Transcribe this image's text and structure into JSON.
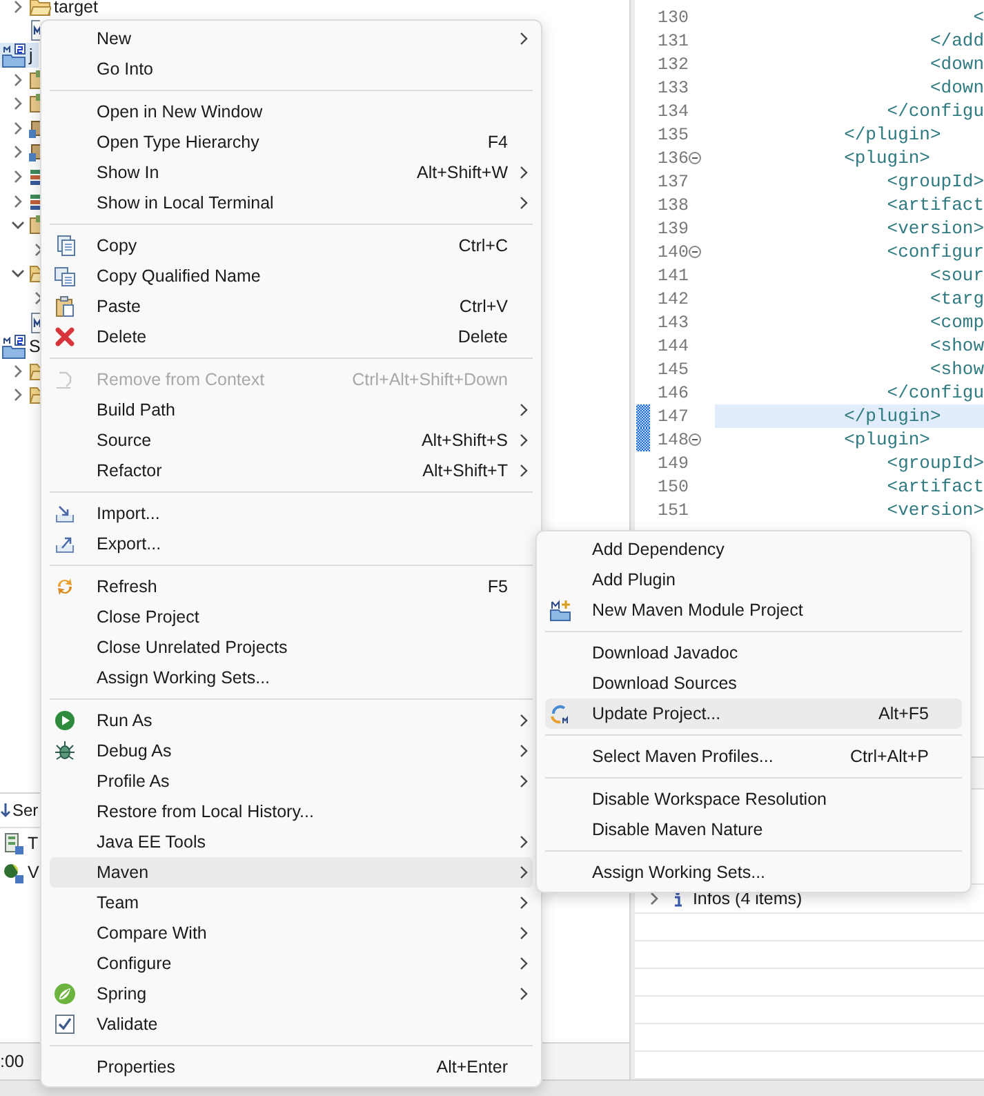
{
  "explorer": {
    "tree": [
      {
        "kind": "folder",
        "label": "target",
        "expanded": false,
        "selected": false
      },
      {
        "kind": "maven-file",
        "selected": false
      },
      {
        "kind": "project",
        "label": "j",
        "selected": true,
        "children": [
          {
            "kind": "source-folder",
            "expanded": false,
            "selected": false
          },
          {
            "kind": "source-folder",
            "expanded": false,
            "selected": false
          },
          {
            "kind": "package",
            "expanded": false,
            "selected": false
          },
          {
            "kind": "package",
            "expanded": false,
            "selected": false
          },
          {
            "kind": "library",
            "expanded": false,
            "selected": false
          },
          {
            "kind": "library",
            "expanded": false,
            "selected": false
          },
          {
            "kind": "source-folder",
            "expanded": true,
            "selected": false,
            "children": [
              {
                "expanded": false,
                "selected": false
              }
            ]
          },
          {
            "kind": "folder",
            "expanded": true,
            "selected": false,
            "children": [
              {
                "expanded": false,
                "selected": false
              }
            ]
          },
          {
            "kind": "maven-file",
            "selected": false
          }
        ]
      },
      {
        "kind": "project",
        "label": "S",
        "selected": false,
        "children": [
          {
            "kind": "folder",
            "expanded": false,
            "selected": false
          },
          {
            "kind": "folder",
            "expanded": false,
            "selected": false
          }
        ]
      }
    ]
  },
  "servers": {
    "tab": "Ser",
    "rows": [
      {
        "kind": "server",
        "label": "T"
      },
      {
        "kind": "spring",
        "label": "V"
      }
    ]
  },
  "status_bar": {
    "text": ":00"
  },
  "editor": {
    "lines": [
      {
        "number": "130",
        "code": "                        <",
        "fold": false,
        "changed": false,
        "highlighted": false
      },
      {
        "number": "131",
        "code": "                    </add",
        "fold": false,
        "changed": false,
        "highlighted": false
      },
      {
        "number": "132",
        "code": "                    <down",
        "fold": false,
        "changed": false,
        "highlighted": false
      },
      {
        "number": "133",
        "code": "                    <down",
        "fold": false,
        "changed": false,
        "highlighted": false
      },
      {
        "number": "134",
        "code": "                </configu",
        "fold": false,
        "changed": false,
        "highlighted": false
      },
      {
        "number": "135",
        "code": "            </plugin>",
        "fold": false,
        "changed": false,
        "highlighted": false
      },
      {
        "number": "136",
        "code": "            <plugin>",
        "fold": true,
        "changed": false,
        "highlighted": false
      },
      {
        "number": "137",
        "code": "                <groupId>",
        "fold": false,
        "changed": false,
        "highlighted": false
      },
      {
        "number": "138",
        "code": "                <artifact",
        "fold": false,
        "changed": false,
        "highlighted": false
      },
      {
        "number": "139",
        "code": "                <version>",
        "fold": false,
        "changed": false,
        "highlighted": false
      },
      {
        "number": "140",
        "code": "                <configur",
        "fold": true,
        "changed": false,
        "highlighted": false
      },
      {
        "number": "141",
        "code": "                    <sour",
        "fold": false,
        "changed": false,
        "highlighted": false
      },
      {
        "number": "142",
        "code": "                    <targ",
        "fold": false,
        "changed": false,
        "highlighted": false
      },
      {
        "number": "143",
        "code": "                    <comp",
        "fold": false,
        "changed": false,
        "highlighted": false
      },
      {
        "number": "144",
        "code": "                    <show",
        "fold": false,
        "changed": false,
        "highlighted": false
      },
      {
        "number": "145",
        "code": "                    <show",
        "fold": false,
        "changed": false,
        "highlighted": false
      },
      {
        "number": "146",
        "code": "                </configu",
        "fold": false,
        "changed": false,
        "highlighted": false
      },
      {
        "number": "147",
        "code": "            </plugin>",
        "fold": false,
        "changed": true,
        "highlighted": true
      },
      {
        "number": "148",
        "code": "            <plugin>",
        "fold": true,
        "changed": true,
        "highlighted": false
      },
      {
        "number": "149",
        "code": "                <groupId>",
        "fold": false,
        "changed": false,
        "highlighted": false
      },
      {
        "number": "150",
        "code": "                <artifact",
        "fold": false,
        "changed": false,
        "highlighted": false
      },
      {
        "number": "151",
        "code": "                <version>",
        "fold": false,
        "changed": false,
        "highlighted": false
      }
    ]
  },
  "problems": {
    "rows": [
      {
        "label": "Infos (4 items)",
        "expanded": false
      }
    ]
  },
  "context_menu": {
    "items": [
      {
        "kind": "item",
        "label": "New",
        "submenu": true,
        "disabled": false,
        "selected": false
      },
      {
        "kind": "item",
        "label": "Go Into",
        "submenu": false,
        "disabled": false,
        "selected": false
      },
      {
        "kind": "separator"
      },
      {
        "kind": "item",
        "label": "Open in New Window",
        "submenu": false,
        "disabled": false,
        "selected": false
      },
      {
        "kind": "item",
        "label": "Open Type Hierarchy",
        "shortcut": "F4",
        "submenu": false,
        "disabled": false,
        "selected": false
      },
      {
        "kind": "item",
        "label": "Show In",
        "shortcut": "Alt+Shift+W",
        "submenu": true,
        "disabled": false,
        "selected": false
      },
      {
        "kind": "item",
        "label": "Show in Local Terminal",
        "submenu": true,
        "disabled": false,
        "selected": false
      },
      {
        "kind": "separator"
      },
      {
        "kind": "copy",
        "label": "Copy",
        "shortcut": "Ctrl+C",
        "submenu": false,
        "disabled": false,
        "selected": false
      },
      {
        "kind": "copy-qualified",
        "label": "Copy Qualified Name",
        "submenu": false,
        "disabled": false,
        "selected": false
      },
      {
        "kind": "paste",
        "label": "Paste",
        "shortcut": "Ctrl+V",
        "submenu": false,
        "disabled": false,
        "selected": false
      },
      {
        "kind": "delete",
        "label": "Delete",
        "shortcut": "Delete",
        "submenu": false,
        "disabled": false,
        "selected": false
      },
      {
        "kind": "separator"
      },
      {
        "kind": "remove",
        "label": "Remove from Context",
        "shortcut": "Ctrl+Alt+Shift+Down",
        "submenu": false,
        "disabled": true,
        "selected": false
      },
      {
        "kind": "item",
        "label": "Build Path",
        "submenu": true,
        "disabled": false,
        "selected": false
      },
      {
        "kind": "item",
        "label": "Source",
        "shortcut": "Alt+Shift+S",
        "submenu": true,
        "disabled": false,
        "selected": false
      },
      {
        "kind": "item",
        "label": "Refactor",
        "shortcut": "Alt+Shift+T",
        "submenu": true,
        "disabled": false,
        "selected": false
      },
      {
        "kind": "separator"
      },
      {
        "kind": "import",
        "label": "Import...",
        "submenu": false,
        "disabled": false,
        "selected": false
      },
      {
        "kind": "export",
        "label": "Export...",
        "submenu": false,
        "disabled": false,
        "selected": false
      },
      {
        "kind": "separator"
      },
      {
        "kind": "refresh",
        "label": "Refresh",
        "shortcut": "F5",
        "submenu": false,
        "disabled": false,
        "selected": false
      },
      {
        "kind": "item",
        "label": "Close Project",
        "submenu": false,
        "disabled": false,
        "selected": false
      },
      {
        "kind": "item",
        "label": "Close Unrelated Projects",
        "submenu": false,
        "disabled": false,
        "selected": false
      },
      {
        "kind": "item",
        "label": "Assign Working Sets...",
        "submenu": false,
        "disabled": false,
        "selected": false
      },
      {
        "kind": "separator"
      },
      {
        "kind": "run",
        "label": "Run As",
        "submenu": true,
        "disabled": false,
        "selected": false
      },
      {
        "kind": "debug",
        "label": "Debug As",
        "submenu": true,
        "disabled": false,
        "selected": false
      },
      {
        "kind": "item",
        "label": "Profile As",
        "submenu": true,
        "disabled": false,
        "selected": false
      },
      {
        "kind": "item",
        "label": "Restore from Local History...",
        "submenu": false,
        "disabled": false,
        "selected": false
      },
      {
        "kind": "item",
        "label": "Java EE Tools",
        "submenu": true,
        "disabled": false,
        "selected": false
      },
      {
        "kind": "item",
        "label": "Maven",
        "submenu": true,
        "disabled": false,
        "selected": true
      },
      {
        "kind": "item",
        "label": "Team",
        "submenu": true,
        "disabled": false,
        "selected": false
      },
      {
        "kind": "item",
        "label": "Compare With",
        "submenu": true,
        "disabled": false,
        "selected": false
      },
      {
        "kind": "item",
        "label": "Configure",
        "submenu": true,
        "disabled": false,
        "selected": false
      },
      {
        "kind": "spring",
        "label": "Spring",
        "submenu": true,
        "disabled": false,
        "selected": false
      },
      {
        "kind": "validate",
        "label": "Validate",
        "submenu": false,
        "disabled": false,
        "selected": false
      },
      {
        "kind": "separator"
      },
      {
        "kind": "item",
        "label": "Properties",
        "shortcut": "Alt+Enter",
        "submenu": false,
        "disabled": false,
        "selected": false
      }
    ]
  },
  "maven_submenu": {
    "items": [
      {
        "kind": "item",
        "label": "Add Dependency",
        "selected": false
      },
      {
        "kind": "item",
        "label": "Add Plugin",
        "selected": false
      },
      {
        "kind": "maven-module",
        "label": "New Maven Module Project",
        "selected": false
      },
      {
        "kind": "separator"
      },
      {
        "kind": "item",
        "label": "Download Javadoc",
        "selected": false
      },
      {
        "kind": "item",
        "label": "Download Sources",
        "selected": false
      },
      {
        "kind": "maven-update",
        "label": "Update Project...",
        "shortcut": "Alt+F5",
        "selected": true
      },
      {
        "kind": "separator"
      },
      {
        "kind": "item",
        "label": "Select Maven Profiles...",
        "shortcut": "Ctrl+Alt+P",
        "selected": false
      },
      {
        "kind": "separator"
      },
      {
        "kind": "item",
        "label": "Disable Workspace Resolution",
        "selected": false
      },
      {
        "kind": "item",
        "label": "Disable Maven Nature",
        "selected": false
      },
      {
        "kind": "separator"
      },
      {
        "kind": "item",
        "label": "Assign Working Sets...",
        "selected": false
      }
    ]
  }
}
